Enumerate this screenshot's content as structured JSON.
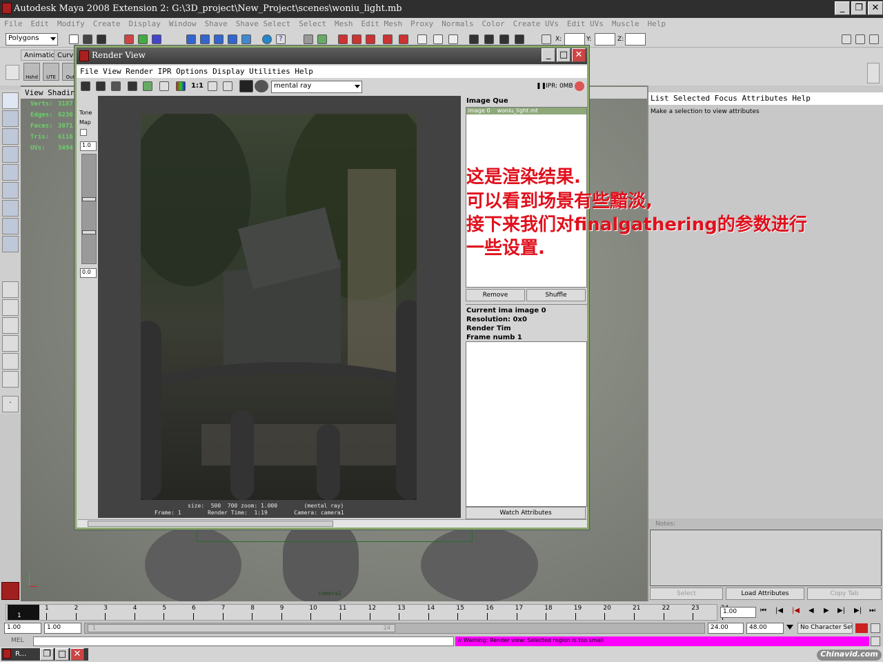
{
  "app": {
    "title": "Autodesk Maya 2008 Extension 2: G:\\3D_project\\New_Project\\scenes\\woniu_light.mb",
    "menu": [
      "File",
      "Edit",
      "Modify",
      "Create",
      "Display",
      "Window",
      "Shave",
      "Shave Select",
      "Select",
      "Mesh",
      "Edit Mesh",
      "Proxy",
      "Normals",
      "Color",
      "Create UVs",
      "Edit UVs",
      "Muscle",
      "Help"
    ],
    "menu_set": "Polygons",
    "coord_labels": {
      "x": "X:",
      "y": "Y:",
      "z": "Z:"
    }
  },
  "shelf": {
    "tabs": [
      "Animation",
      "Curves"
    ],
    "buttons": [
      "Hshd",
      "UTE",
      "Out"
    ]
  },
  "viewport": {
    "menu": [
      "View",
      "Shadin"
    ],
    "hud": [
      {
        "label": "Verts:",
        "value": "3187"
      },
      {
        "label": "Edges:",
        "value": "6236"
      },
      {
        "label": "Faces:",
        "value": "3071"
      },
      {
        "label": "Tris:",
        "value": "6116"
      },
      {
        "label": "UVs:",
        "value": "3494"
      }
    ],
    "camera_label": "camera1"
  },
  "render_view": {
    "title": "Render View",
    "menu": [
      "File",
      "View",
      "Render",
      "IPR",
      "Options",
      "Display",
      "Utilities",
      "Help"
    ],
    "renderer": "mental ray",
    "ratio_button": "1:1",
    "ipr_status": "IPR: 0MB",
    "tone_map_label": "Tone Map",
    "tone_high": "1.0",
    "tone_low": "0.0",
    "info_line1": "size:  500  700 zoom: 1.000        (mental ray)",
    "info_line2": "Frame: 1        Render Time:  1:19        Camera: camera1",
    "image_queue": {
      "heading": "Image Que",
      "items": [
        {
          "name": "image 0",
          "file": "woniu_light.mt"
        }
      ],
      "remove": "Remove",
      "shuffle": "Shuffle"
    },
    "details": [
      {
        "label": "Current ima",
        "value": "image 0"
      },
      {
        "label": "Resolution:",
        "value": "0x0"
      },
      {
        "label": "Render Tim",
        "value": ""
      },
      {
        "label": "Frame numb",
        "value": "1"
      }
    ],
    "watch": "Watch Attributes"
  },
  "annotation": {
    "lines": [
      "这是渲染结果.",
      "可以看到场景有些黯淡,",
      "接下来我们对finalgathering的参数进行",
      "一些设置."
    ],
    "color": "#e0101c"
  },
  "attribute_editor": {
    "menu": [
      "List",
      "Selected",
      "Focus",
      "Attributes",
      "Help"
    ],
    "message": "Make a selection to view attributes",
    "notes_label": "Notes:",
    "buttons": [
      "Select",
      "Load Attributes",
      "Copy Tab"
    ]
  },
  "timeline": {
    "ticks": [
      "1",
      "2",
      "3",
      "4",
      "5",
      "6",
      "7",
      "8",
      "9",
      "10",
      "11",
      "12",
      "13",
      "14",
      "15",
      "16",
      "17",
      "18",
      "19",
      "20",
      "21",
      "22",
      "23",
      "24"
    ],
    "current_frame": "1.00",
    "current_marker": "1"
  },
  "range": {
    "start": "1.00",
    "playback_start": "1.00",
    "slider_start": "1",
    "slider_end": "24",
    "playback_end": "24.00",
    "end": "48.00",
    "character_set": "No Character Set"
  },
  "command": {
    "label": "MEL",
    "warning": "// Warning: Render view: Selected region is too small",
    "warning_color": "#ff00ff"
  },
  "taskbar": {
    "item": "R...",
    "watermark": "Chinavid.com"
  }
}
